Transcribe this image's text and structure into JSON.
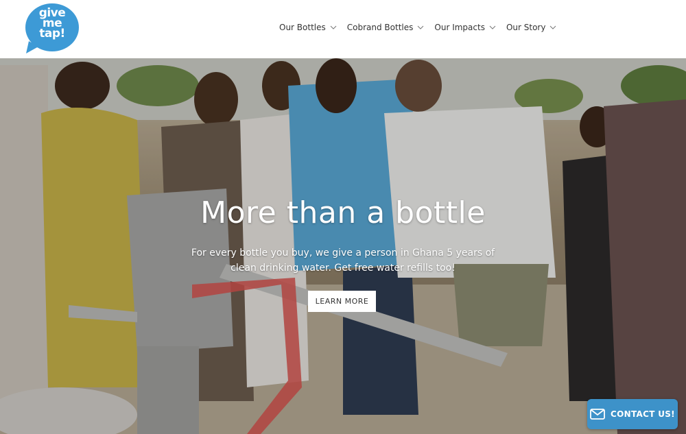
{
  "brand": {
    "logo_text_line1": "give",
    "logo_text_line2": "me",
    "logo_text_line3": "tap!",
    "color": "#3d9ad6"
  },
  "nav": {
    "items": [
      {
        "label": "Our Bottles"
      },
      {
        "label": "Cobrand Bottles"
      },
      {
        "label": "Our Impacts"
      },
      {
        "label": "Our Story"
      }
    ]
  },
  "hero": {
    "headline": "More than a bottle",
    "subline": "For every bottle you buy, we give a person in Ghana 5 years of clean drinking water. Get free water refills too!",
    "cta_label": "LEARN MORE"
  },
  "contact": {
    "label": "CONTACT US!",
    "color": "#3d92c9"
  }
}
